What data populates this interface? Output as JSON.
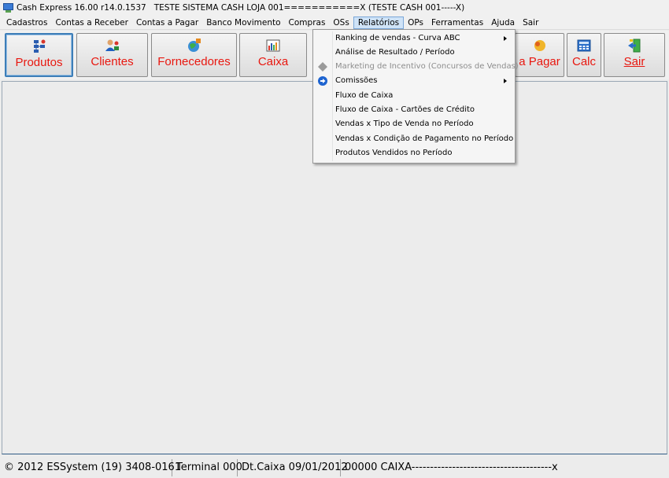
{
  "window": {
    "title": "Cash Express 16.00 r14.0.1537   TESTE SISTEMA CASH LOJA 001===========X (TESTE CASH 001-----X)"
  },
  "menubar": {
    "items": [
      {
        "label": "Cadastros"
      },
      {
        "label": "Contas a Receber"
      },
      {
        "label": "Contas a Pagar"
      },
      {
        "label": "Banco Movimento"
      },
      {
        "label": "Compras"
      },
      {
        "label": "OSs"
      },
      {
        "label": "Relatórios"
      },
      {
        "label": "OPs"
      },
      {
        "label": "Ferramentas"
      },
      {
        "label": "Ajuda"
      },
      {
        "label": "Sair"
      }
    ]
  },
  "toolbar": {
    "buttons": [
      {
        "label": "Produtos",
        "icon": "products-icon"
      },
      {
        "label": "Clientes",
        "icon": "clients-icon"
      },
      {
        "label": "Fornecedores",
        "icon": "suppliers-icon"
      },
      {
        "label": "Caixa",
        "icon": "cash-register-icon"
      },
      {
        "label": "a Pagar",
        "icon": "payables-icon"
      },
      {
        "label": "Calc",
        "icon": "calculator-icon"
      },
      {
        "label": "Sair",
        "icon": "exit-icon"
      }
    ]
  },
  "relatorios_menu": {
    "items": [
      {
        "label": "Ranking de vendas - Curva ABC",
        "submenu": true,
        "disabled": false
      },
      {
        "label": "Análise de Resultado / Período",
        "submenu": false,
        "disabled": false
      },
      {
        "label": "Marketing de Incentivo (Concursos de Vendas)",
        "submenu": false,
        "disabled": true,
        "icon": "diamond-icon"
      },
      {
        "label": "Comissões",
        "submenu": true,
        "disabled": false,
        "icon": "blue-arrow-icon"
      },
      {
        "label": "Fluxo de Caixa",
        "submenu": false,
        "disabled": false
      },
      {
        "label": "Fluxo de Caixa - Cartões de Crédito",
        "submenu": false,
        "disabled": false
      },
      {
        "label": "Vendas x Tipo de Venda no Período",
        "submenu": false,
        "disabled": false
      },
      {
        "label": "Vendas x Condição de Pagamento no Período",
        "submenu": false,
        "disabled": false
      },
      {
        "label": "Produtos Vendidos no Período",
        "submenu": false,
        "disabled": false
      }
    ]
  },
  "statusbar": {
    "copyright": "© 2012 ESSystem (19) 3408-0161",
    "terminal": "Terminal 000",
    "date": "Dt.Caixa 09/01/2012",
    "caixa": "00000 CAIXA--------------------------------------x"
  },
  "colors": {
    "button_label": "#e8170f",
    "menu_active_bg": "#cfe3f7",
    "focus_border": "#3d7eb8"
  }
}
